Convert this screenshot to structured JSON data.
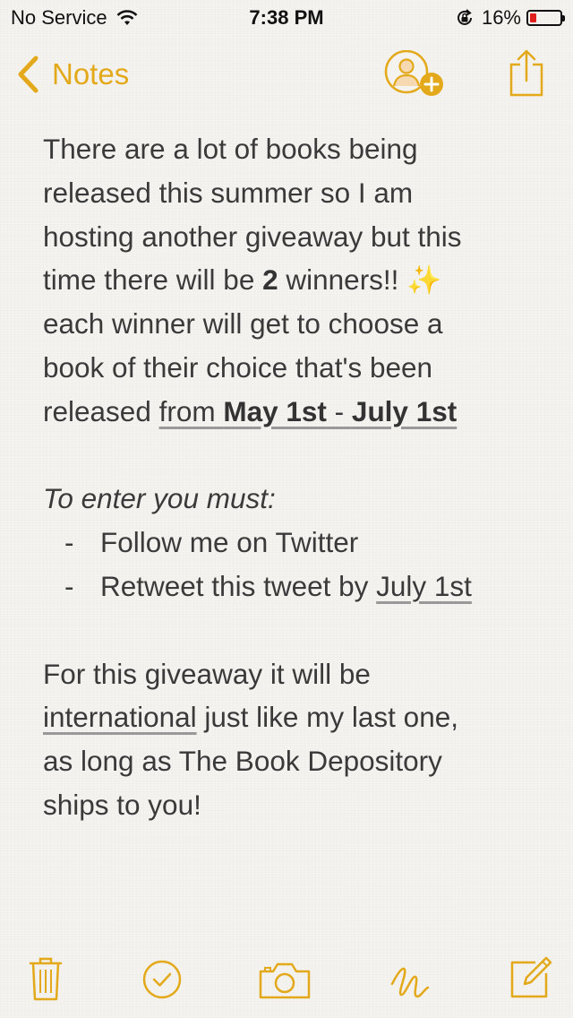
{
  "status_bar": {
    "carrier": "No Service",
    "time": "7:38 PM",
    "battery_percent_label": "16%",
    "battery_level": 0.16,
    "icons": [
      "wifi-icon",
      "rotation-lock-icon",
      "battery-icon"
    ]
  },
  "nav": {
    "back_label": "Notes",
    "icons": [
      "chevron-left-icon",
      "add-people-icon",
      "share-icon"
    ]
  },
  "note": {
    "p1": {
      "l1": "There are a lot of books being",
      "l2": "released this summer so I am",
      "l3": "hosting another giveaway but this",
      "l4a": "time there will be ",
      "l4b": "2",
      "l4c": " winners!! ",
      "l4d": "✨",
      "l5": "each winner will get to choose a",
      "l6": "book of their choice that's been",
      "l7a": "released ",
      "l7b": "from ",
      "l7c": "May 1st",
      "l7d": " - ",
      "l7e": "July 1st"
    },
    "p2": {
      "heading": "To enter you must:",
      "dash": "-",
      "bullet1": "Follow me on Twitter",
      "bullet2a": "Retweet this tweet by ",
      "bullet2b": "July 1st"
    },
    "p3": {
      "l1": "For this giveaway it will be",
      "l2a": "international",
      "l2b": " just like my last one,",
      "l3": "as long as The Book Depository",
      "l4": "ships to you!"
    }
  },
  "toolbar": {
    "icons": [
      "trash-icon",
      "checklist-icon",
      "camera-icon",
      "sketch-icon",
      "compose-icon"
    ]
  },
  "colors": {
    "accent": "#e3a91a",
    "battery_low": "#e0201c",
    "text": "#3a3a3a",
    "paper": "#f4f3f0"
  }
}
